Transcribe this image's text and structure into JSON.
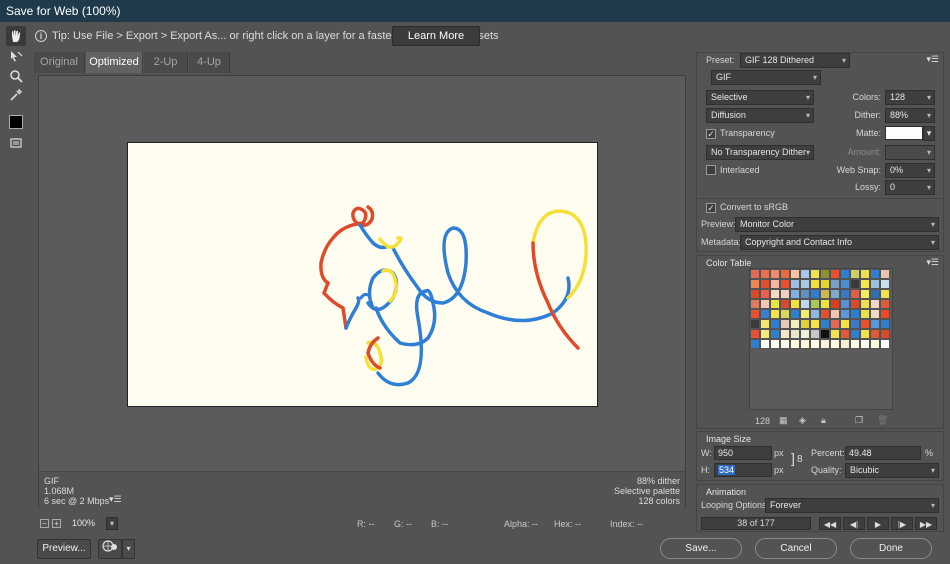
{
  "window": {
    "title": "Save for Web (100%)"
  },
  "tools": [
    {
      "name": "hand-tool-icon"
    },
    {
      "name": "slice-select-tool-icon"
    },
    {
      "name": "zoom-tool-icon"
    },
    {
      "name": "eyedropper-tool-icon"
    },
    {
      "name": "eyedropper-color-swatch"
    },
    {
      "name": "toggle-slices-icon"
    }
  ],
  "tip": {
    "text": "Tip: Use File > Export > Export As...  or right click on a layer for a faster way to export assets",
    "learn_more": "Learn More"
  },
  "tabs": [
    "Original",
    "Optimized",
    "2-Up",
    "4-Up"
  ],
  "active_tab": "Optimized",
  "image_info": {
    "format": "GIF",
    "size": "1.068M",
    "time": "6 sec @ 2 Mbps",
    "dither": "88% dither",
    "palette": "Selective palette",
    "colors": "128 colors"
  },
  "status": {
    "zoom": "100%",
    "r": "R: --",
    "g": "G: --",
    "b": "B: --",
    "alpha": "Alpha: --",
    "hex": "Hex: --",
    "index": "Index: --"
  },
  "bottom": {
    "preview": "Preview...",
    "save": "Save...",
    "cancel": "Cancel",
    "done": "Done"
  },
  "settings": {
    "preset_label": "Preset:",
    "preset_value": "GIF 128 Dithered",
    "format": "GIF",
    "reduction": "Selective",
    "dither_algo": "Diffusion",
    "colors_label": "Colors:",
    "colors_value": "128",
    "dither_label": "Dither:",
    "dither_value": "88%",
    "transparency_label": "Transparency",
    "matte_label": "Matte:",
    "transparency_dither": "No Transparency Dither",
    "amount_label": "Amount:",
    "interlaced_label": "Interlaced",
    "websnap_label": "Web Snap:",
    "websnap_value": "0%",
    "lossy_label": "Lossy:",
    "lossy_value": "0",
    "convert_srgb_label": "Convert to sRGB",
    "preview_label": "Preview:",
    "preview_value": "Monitor Color",
    "metadata_label": "Metadata:",
    "metadata_value": "Copyright and Contact Info"
  },
  "color_table": {
    "title": "Color Table",
    "count": "128",
    "swatches": [
      "#e06a55",
      "#e8714d",
      "#f08a6e",
      "#e86a3e",
      "#f6c6a4",
      "#a7c7e7",
      "#f2e24b",
      "#8a8f3a",
      "#e85030",
      "#2f7fcf",
      "#c9d06a",
      "#f0e050",
      "#2f7fcf",
      "#e8c4b0",
      "#f08550",
      "#e05030",
      "#f3b7a0",
      "#e85030",
      "#a0c0e0",
      "#a8c8e0",
      "#f2e03c",
      "#e0d830",
      "#7aa0c8",
      "#4a8fd0",
      "#3a3a3a",
      "#f2e850",
      "#a0c0e0",
      "#c8e0f0",
      "#d84a2a",
      "#e86050",
      "#f4d8c4",
      "#f0d0c0",
      "#80b0e0",
      "#6090c0",
      "#2f7fcf",
      "#c8b858",
      "#80a8d0",
      "#3a78c0",
      "#e06040",
      "#f2ea60",
      "#2f6fb0",
      "#f2e24b",
      "#e07a60",
      "#f2c8b4",
      "#e8e840",
      "#d84a30",
      "#f2e03c",
      "#c0d8ee",
      "#a8c858",
      "#f0e040",
      "#d84020",
      "#5890d0",
      "#d84a2a",
      "#e8e050",
      "#f0d4c4",
      "#e05a3a",
      "#e85030",
      "#3a80d0",
      "#f2e24b",
      "#d8d860",
      "#2f7fcf",
      "#f2ec70",
      "#90b8e0",
      "#e05030",
      "#f0c4b0",
      "#5a98d8",
      "#2f7fcf",
      "#e8e04a",
      "#f0d8c8",
      "#e84a2a",
      "#3a3a3a",
      "#f2e870",
      "#2f7fcf",
      "#e8c8b8",
      "#f0f0c0",
      "#e0d040",
      "#f2e24b",
      "#2f7fcf",
      "#e06a55",
      "#f2e24b",
      "#3c7ac8",
      "#e85030",
      "#5a98d8",
      "#2f7fcf",
      "#e85030",
      "#f2ea80",
      "#2f7fcf",
      "#f4e8c8",
      "#e8e8c8",
      "#f0f0d8",
      "#c8c8c8",
      "#101010",
      "#f2e24b",
      "#e05a3a",
      "#2f7fcf",
      "#f2e24b",
      "#e05a3a",
      "#d84a2a",
      "#2f7fcf",
      "#ffffff",
      "#fffdf0",
      "#f8f8e8",
      "#fffbe0",
      "#fff8d8",
      "#fdfde8",
      "#f8f4d8",
      "#fffce8",
      "#f4f0d0",
      "#fefce8",
      "#fafaf0",
      "#fcfce0",
      "#ffffff"
    ]
  },
  "image_size": {
    "title": "Image Size",
    "w_label": "W:",
    "w_value": "950",
    "h_label": "H:",
    "h_value": "534",
    "unit": "px",
    "percent_label": "Percent:",
    "percent_value": "49.48",
    "percent_unit": "%",
    "quality_label": "Quality:",
    "quality_value": "Bicubic"
  },
  "animation": {
    "title": "Animation",
    "looping_label": "Looping Options:",
    "looping_value": "Forever",
    "frame_counter": "38 of 177"
  },
  "colors": {
    "red": "#e04a2a",
    "blue": "#2f7fd6",
    "yellow": "#f5e03a",
    "canvas_bg": "#fffdf0"
  }
}
